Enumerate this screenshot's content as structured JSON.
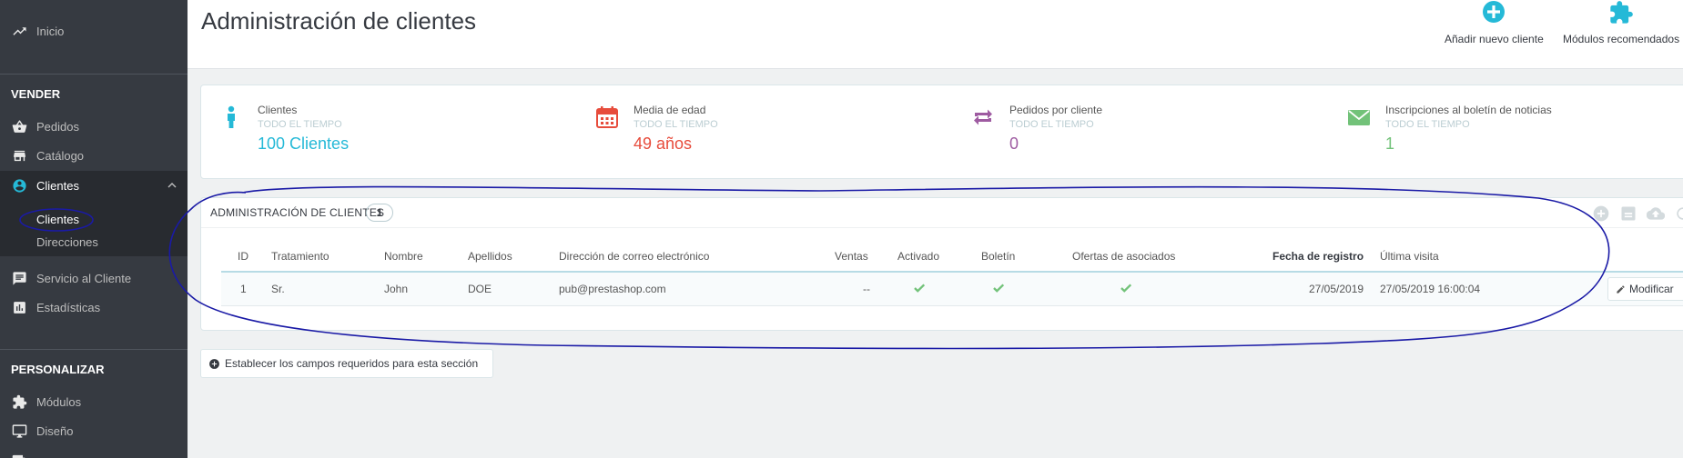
{
  "sidebar": {
    "inicio": "Inicio",
    "section_vender": "VENDER",
    "items": [
      {
        "label": "Pedidos",
        "icon": "basket-icon"
      },
      {
        "label": "Catálogo",
        "icon": "store-icon"
      },
      {
        "label": "Clientes",
        "icon": "account-circle-icon"
      }
    ],
    "clientes_sub": [
      "Clientes",
      "Direcciones"
    ],
    "items2": [
      {
        "label": "Servicio al Cliente",
        "icon": "chat-icon"
      },
      {
        "label": "Estadísticas",
        "icon": "bar-chart-icon"
      }
    ],
    "section_personalizar": "PERSONALIZAR",
    "items3": [
      {
        "label": "Módulos",
        "icon": "puzzle-icon"
      },
      {
        "label": "Diseño",
        "icon": "monitor-icon"
      }
    ]
  },
  "header": {
    "title": "Administración de clientes",
    "add_customer": "Añadir nuevo cliente",
    "recommended_modules": "Módulos recomendados"
  },
  "kpis": [
    {
      "title": "Clientes",
      "period": "TODO EL TIEMPO",
      "value": "100 Clientes",
      "color": "#25b9d7",
      "icon": "person-icon"
    },
    {
      "title": "Media de edad",
      "period": "TODO EL TIEMPO",
      "value": "49 años",
      "color": "#e74c3c",
      "icon": "calendar-icon"
    },
    {
      "title": "Pedidos por cliente",
      "period": "TODO EL TIEMPO",
      "value": "0",
      "color": "#9e5ba1",
      "icon": "repeat-icon"
    },
    {
      "title": "Inscripciones al boletín de noticias",
      "period": "TODO EL TIEMPO",
      "value": "1",
      "color": "#72c279",
      "icon": "envelope-icon"
    }
  ],
  "list": {
    "title": "ADMINISTRACIÓN DE CLIENTES",
    "count": "1",
    "columns": {
      "id": "ID",
      "social_title": "Tratamiento",
      "firstname": "Nombre",
      "lastname": "Apellidos",
      "email": "Dirección de correo electrónico",
      "sales": "Ventas",
      "active": "Activado",
      "newsletter": "Boletín",
      "optin": "Ofertas de asociados",
      "date_add": "Fecha de registro",
      "last_visit": "Última visita"
    },
    "rows": [
      {
        "id": "1",
        "social_title": "Sr.",
        "firstname": "John",
        "lastname": "DOE",
        "email": "pub@prestashop.com",
        "sales": "--",
        "date_add": "27/05/2019",
        "last_visit": "27/05/2019 16:00:04",
        "edit": "Modificar"
      }
    ]
  },
  "required_fields_button": "Establecer los campos requeridos para esta sección",
  "colors": {
    "sidebar_bg": "#363a41",
    "accent": "#25b9d7",
    "annotation": "#1a1aa6"
  }
}
